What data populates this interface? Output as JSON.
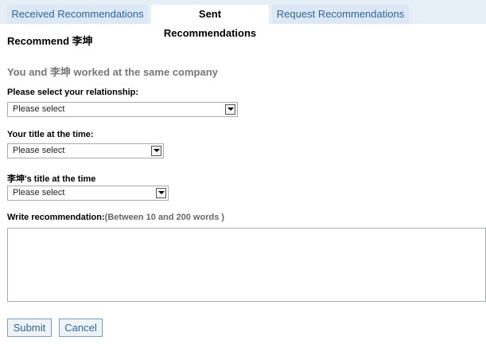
{
  "tabs": [
    {
      "label": "Received Recommendations",
      "active": false
    },
    {
      "label": "Sent Recommendations",
      "active": true
    },
    {
      "label": "Request Recommendations",
      "active": false
    }
  ],
  "heading": "Recommend 李坤",
  "subheading": "You and 李坤 worked at the same company",
  "form": {
    "relationship": {
      "label": "Please select your relationship:",
      "value": "Please select"
    },
    "your_title": {
      "label": "Your title at the time:",
      "value": "Please select"
    },
    "their_title": {
      "label": "李坤's title at the time",
      "value": "Please select"
    },
    "recommendation": {
      "label": "Write recommendation:",
      "hint": "(Between 10 and 200 words )",
      "value": ""
    }
  },
  "buttons": {
    "submit": "Submit",
    "cancel": "Cancel"
  },
  "colors": {
    "tab_bar": "#e6eef6",
    "tab_inactive": "#dce8f5",
    "link": "#2f6699"
  }
}
